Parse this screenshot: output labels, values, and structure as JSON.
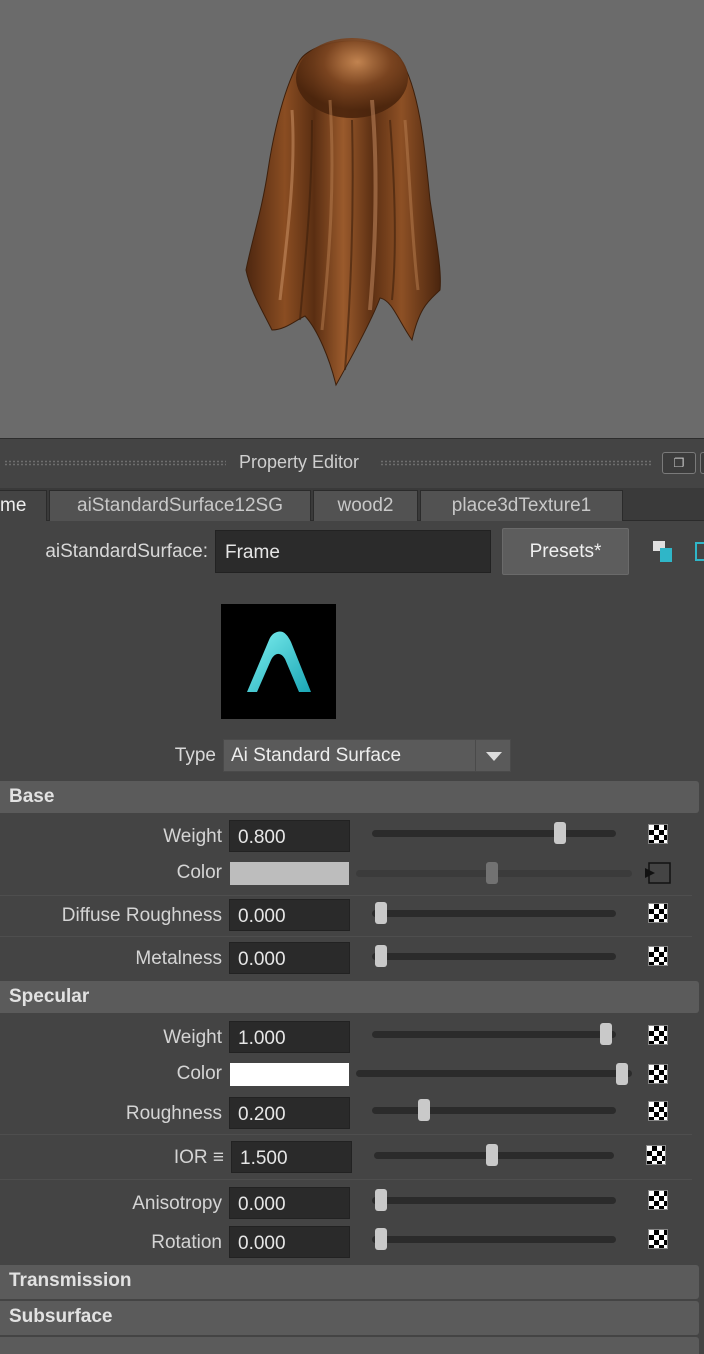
{
  "property_editor": {
    "title": "Property Editor",
    "tabs": [
      {
        "label": "me",
        "active": true
      },
      {
        "label": "aiStandardSurface12SG",
        "active": false
      },
      {
        "label": "wood2",
        "active": false
      },
      {
        "label": "place3dTexture1",
        "active": false
      }
    ],
    "node_type_label": "aiStandardSurface:",
    "node_name": "Frame",
    "presets_label": "Presets*",
    "type_label": "Type",
    "type_value": "Ai Standard Surface"
  },
  "sections": {
    "base": "Base",
    "specular": "Specular",
    "transmission": "Transmission",
    "subsurface": "Subsurface"
  },
  "base": {
    "weight": {
      "label": "Weight",
      "value": "0.800",
      "slider": 0.8
    },
    "color": {
      "label": "Color",
      "swatch": "#bdbdbd",
      "slider": 0.5
    },
    "diffuse_roughness": {
      "label": "Diffuse Roughness",
      "value": "0.000",
      "slider": 0.0
    },
    "metalness": {
      "label": "Metalness",
      "value": "0.000",
      "slider": 0.0
    }
  },
  "specular": {
    "weight": {
      "label": "Weight",
      "value": "1.000",
      "slider": 1.0
    },
    "color": {
      "label": "Color",
      "swatch": "#ffffff",
      "slider": 1.0
    },
    "roughness": {
      "label": "Roughness",
      "value": "0.200",
      "slider": 0.2
    },
    "ior": {
      "label": "IOR ≡",
      "value": "1.500",
      "slider": 0.5
    },
    "anisotropy": {
      "label": "Anisotropy",
      "value": "0.000",
      "slider": 0.0
    },
    "rotation": {
      "label": "Rotation",
      "value": "0.000",
      "slider": 0.0
    }
  },
  "colors": {
    "viewport_bg": "#6b6b6b",
    "panel_bg": "#444444",
    "section_bg": "#5b5b5b",
    "field_bg": "#2a2a2a",
    "arnold_cyan": "#2fc3cf",
    "wood": "#7a4420"
  },
  "icons": {
    "float_window": "float-window-icon",
    "material_swatch": "arnold-logo-icon",
    "map_button": "checker-map-icon",
    "connection": "input-connection-icon"
  }
}
